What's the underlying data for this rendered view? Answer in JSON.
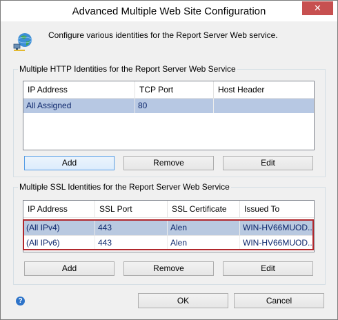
{
  "window": {
    "title": "Advanced Multiple Web Site Configuration",
    "close_glyph": "✕"
  },
  "intro": {
    "icon": "globe-network-icon",
    "text": "Configure various identities for the Report Server Web service."
  },
  "http_group": {
    "legend": "Multiple HTTP Identities for the Report Server Web Service",
    "columns": [
      "IP Address",
      "TCP Port",
      "Host Header"
    ],
    "rows": [
      {
        "ip": "All Assigned",
        "port": "80",
        "host": ""
      }
    ],
    "buttons": {
      "add": "Add",
      "remove": "Remove",
      "edit": "Edit"
    }
  },
  "ssl_group": {
    "legend": "Multiple SSL Identities for the Report Server Web Service",
    "columns": [
      "IP Address",
      "SSL Port",
      "SSL Certificate",
      "Issued To"
    ],
    "rows": [
      {
        "ip": "(All IPv4)",
        "port": "443",
        "cert": "Alen",
        "issued": "WIN-HV66MUOD..."
      },
      {
        "ip": "(All IPv6)",
        "port": "443",
        "cert": "Alen",
        "issued": "WIN-HV66MUOD..."
      }
    ],
    "buttons": {
      "add": "Add",
      "remove": "Remove",
      "edit": "Edit"
    }
  },
  "footer": {
    "help_glyph": "?",
    "ok": "OK",
    "cancel": "Cancel"
  },
  "colors": {
    "selection": "#b7c8e3",
    "highlight_border": "#b0272c",
    "help_blue": "#2e74c9"
  }
}
